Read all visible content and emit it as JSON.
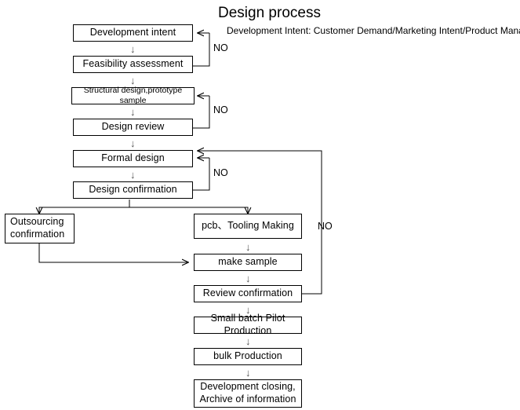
{
  "header": {
    "title": "Design process",
    "subtitle": "Development Intent: Customer Demand/Marketing Intent/Product Manager"
  },
  "nodes": {
    "development_intent": "Development intent",
    "feasibility_assessment": "Feasibility assessment",
    "structural_design": "Structural design,prototype sample",
    "design_review": "Design review",
    "formal_design": "Formal design",
    "design_confirmation": "Design confirmation",
    "outsourcing_confirmation": "Outsourcing\nconfirmation",
    "pcb_tooling_making": "pcb、Tooling Making",
    "make_sample": "make sample",
    "review_confirmation": "Review confirmation",
    "small_batch_pilot": "Small batch Pilot Production",
    "bulk_production": "bulk Production",
    "development_closing": "Development closing,\nArchive of information"
  },
  "edge_labels": {
    "no_feasibility": "NO",
    "no_design_review": "NO",
    "no_design_confirmation": "NO",
    "no_review_confirmation": "NO"
  },
  "arrow_glyph": "↓",
  "colors": {
    "stroke": "#000000",
    "node_fill": "#ffffff",
    "text": "#000000",
    "background": "#ffffff"
  }
}
